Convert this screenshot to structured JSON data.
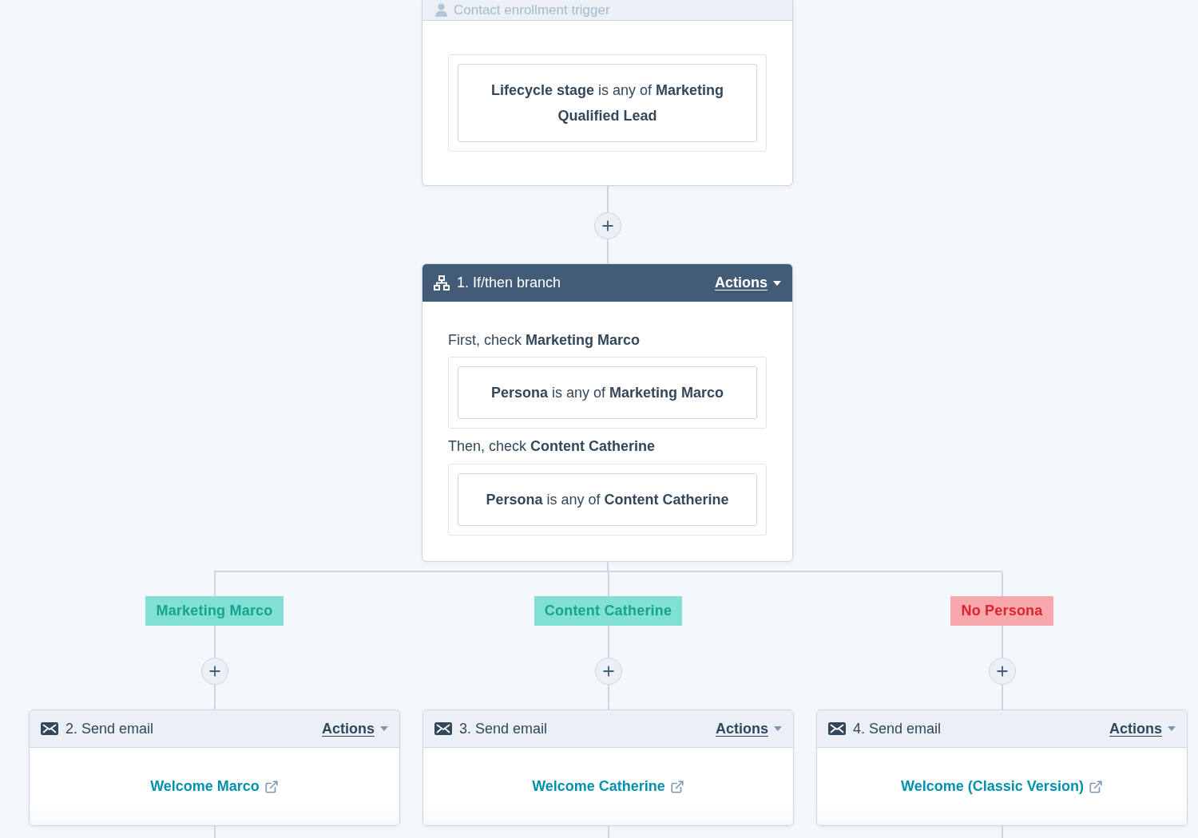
{
  "trigger": {
    "title": "Contact enrollment trigger",
    "filter": "**Lifecycle stage** is any of **Marketing Qualified Lead**"
  },
  "branch_step": {
    "title": "1. If/then branch",
    "actions_label": "Actions",
    "checks": [
      {
        "heading": "First, check **Marketing Marco**",
        "filter": "**Persona** is any of **Marketing Marco**"
      },
      {
        "heading": "Then, check **Content Catherine**",
        "filter": "**Persona** is any of **Content Catherine**"
      }
    ]
  },
  "branches": [
    {
      "label": "Marketing Marco",
      "color": "#80e0d3",
      "step": {
        "title": "2. Send email",
        "actions_label": "Actions",
        "email": "Welcome Marco"
      }
    },
    {
      "label": "Content Catherine",
      "color": "#80e0d3",
      "step": {
        "title": "3. Send email",
        "actions_label": "Actions",
        "email": "Welcome Catherine"
      }
    },
    {
      "label": "No Persona",
      "color": "#f8a8ac",
      "step": {
        "title": "4. Send email",
        "actions_label": "Actions",
        "email": "Welcome (Classic Version)"
      }
    }
  ]
}
